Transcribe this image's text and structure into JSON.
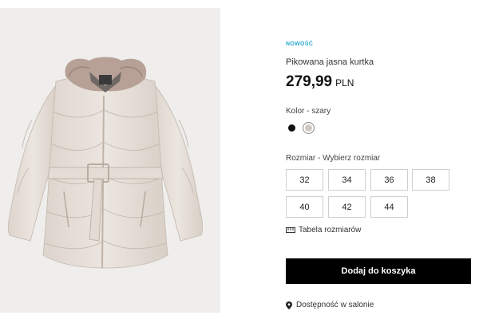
{
  "product": {
    "badge": "NOWOŚĆ",
    "name": "Pikowana jasna kurtka",
    "price_value": "279,99",
    "price_currency": "PLN",
    "image_alt": "Pikowana jasna kurtka z futrzanym kołnierzem"
  },
  "color": {
    "label": "Kolor - ",
    "selected": "szary",
    "options": [
      {
        "name": "czarny",
        "hex": "#111111"
      },
      {
        "name": "szary",
        "hex": "#cfc8c0"
      }
    ]
  },
  "size": {
    "label": "Rozmiar - ",
    "prompt": "Wybierz rozmiar",
    "options": [
      "32",
      "34",
      "36",
      "38",
      "40",
      "42",
      "44"
    ]
  },
  "size_table_label": "Tabela rozmiarów",
  "add_to_cart_label": "Dodaj do koszyka",
  "store_availability_label": "Dostępność w salonie",
  "colors": {
    "accent": "#2aa9d0",
    "button_bg": "#000000",
    "button_text": "#ffffff",
    "image_bg": "#efeeec"
  },
  "icons": {
    "ruler": "ruler-icon",
    "location": "map-pin-icon"
  }
}
